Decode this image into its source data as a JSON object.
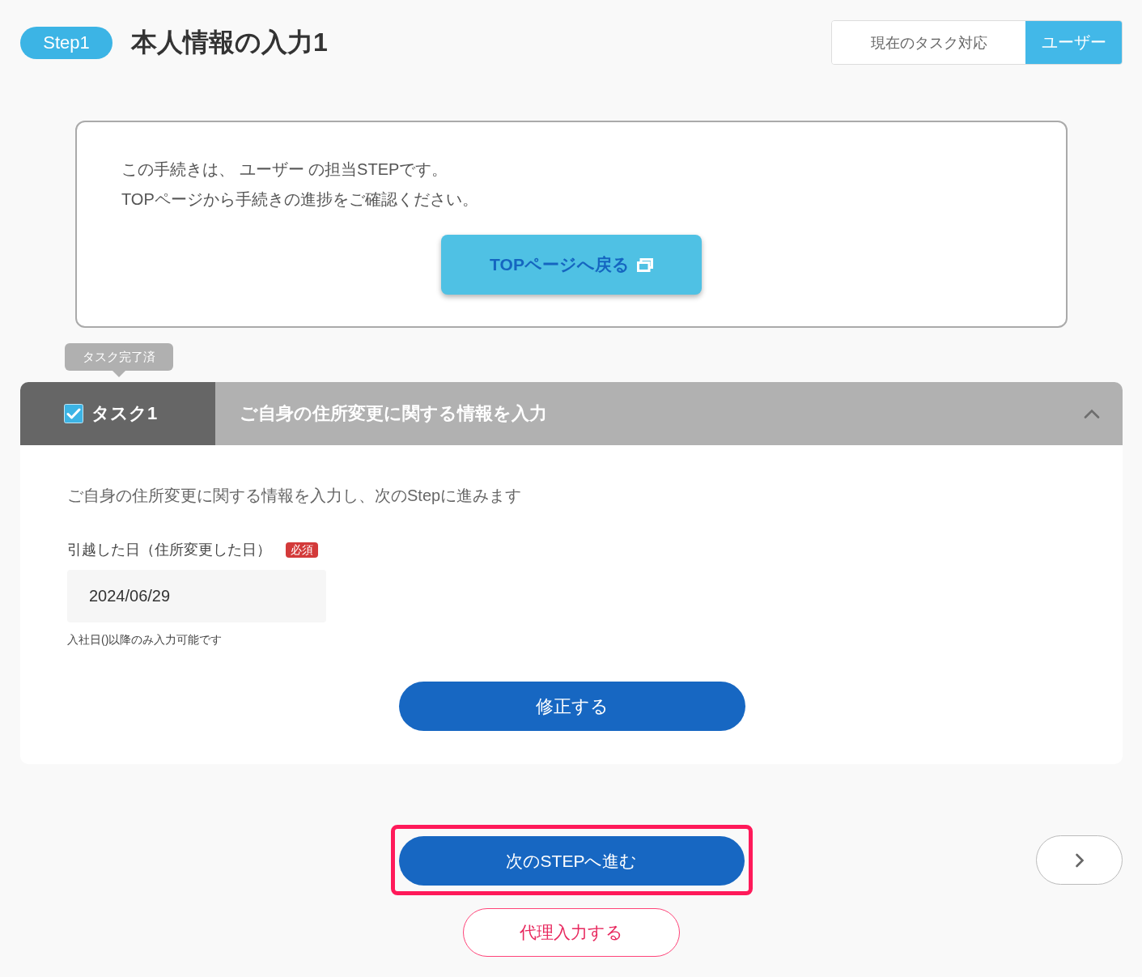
{
  "header": {
    "step_badge": "Step1",
    "title": "本人情報の入力1",
    "task_owner": {
      "label": "現在のタスク対応",
      "value": "ユーザー"
    }
  },
  "notice": {
    "lines": [
      "この手続きは、 ユーザー の担当STEPです。",
      "TOPページから手続きの進捗をご確認ください。"
    ],
    "button": "TOPページへ戻る"
  },
  "task": {
    "status_tooltip": "タスク完了済",
    "checked": true,
    "label": "タスク1",
    "title": "ご自身の住所変更に関する情報を入力",
    "expanded": true,
    "description": "ご自身の住所変更に関する情報を入力し、次のStepに進みます",
    "fields": [
      {
        "label": "引越した日（住所変更した日）",
        "required_badge": "必須",
        "value": "2024/06/29",
        "hint": "入社日()以降のみ入力可能です"
      }
    ],
    "button": "修正する"
  },
  "footer": {
    "next_button": {
      "label": "次のSTEPへ進む",
      "highlighted": true
    },
    "proxy_button": "代理入力する"
  }
}
